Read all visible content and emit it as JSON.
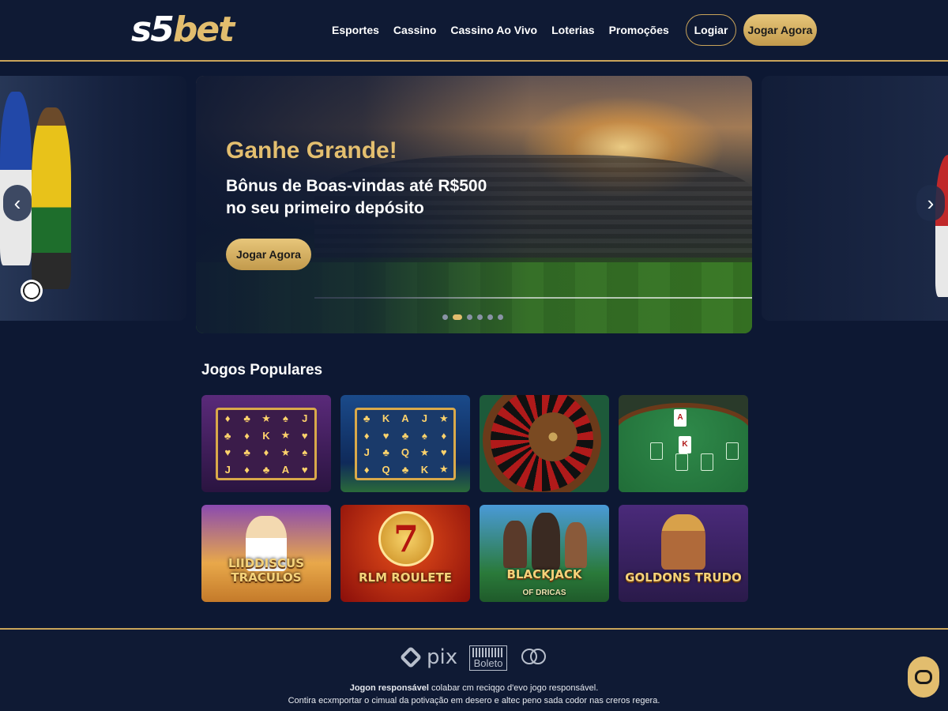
{
  "brand": {
    "logo_part1": "s5",
    "logo_part2": "bet"
  },
  "nav": {
    "items": [
      "Esportes",
      "Cassino",
      "Cassino Ao Vivo",
      "Loterias",
      "Promoções"
    ]
  },
  "header": {
    "login_label": "Logiar",
    "play_label": "Jogar Agora"
  },
  "carousel": {
    "prev_icon": "chevron-left-icon",
    "next_icon": "chevron-right-icon",
    "prev_glyph": "‹",
    "next_glyph": "›",
    "slide_count": 6,
    "active_index": 1
  },
  "hero": {
    "title": "Ganhe Grande!",
    "subtitle": "Bônus de Boas-vindas até R$500 no seu primeiro depósito",
    "button_label": "Jogar Agora"
  },
  "games": {
    "section_title": "Jogos Populares",
    "items": [
      {
        "name": "",
        "sub": ""
      },
      {
        "name": "",
        "sub": ""
      },
      {
        "name": "",
        "sub": ""
      },
      {
        "name": "",
        "sub": ""
      },
      {
        "name": "LIIDDISCUS TRACULOS",
        "sub": ""
      },
      {
        "name": "RLM ROULETE",
        "sub": ""
      },
      {
        "name": "BLACKJACK",
        "sub": "OF DRICAS"
      },
      {
        "name": "GOLDONS TRUDO",
        "sub": ""
      }
    ],
    "seven_glyph": "7"
  },
  "footer": {
    "payments": {
      "pix": "pix",
      "boleto": "Boleto"
    },
    "line1_bold": "Jogon responsável",
    "line1_rest": " colabar cm reciqgo d'evo jogo responsável.",
    "line2": "Contira ecxmportar o cimual da potivação em desero e altec peno sada codor nas creros regera."
  },
  "colors": {
    "gold": "#e2bd6e",
    "navy": "#0d1833",
    "border_gold": "#c9a45a"
  }
}
